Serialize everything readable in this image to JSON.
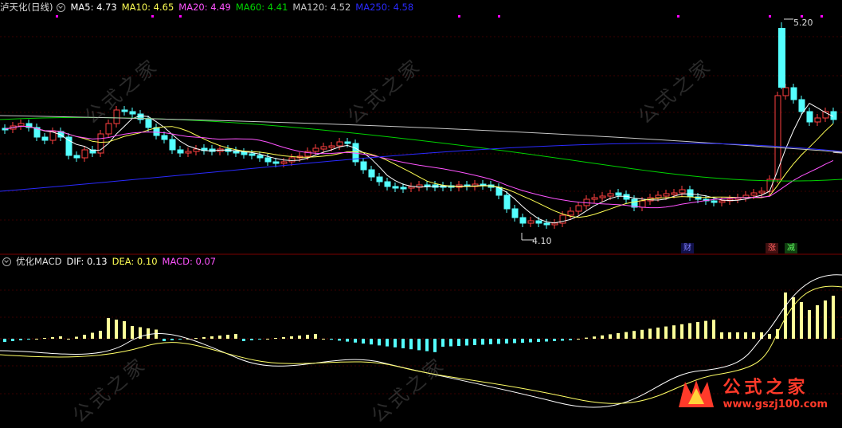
{
  "main_legend": {
    "title": "泸天化(日线)",
    "ma5": "MA5: 4.73",
    "ma10": "MA10: 4.65",
    "ma20": "MA20: 4.49",
    "ma60": "MA60: 4.41",
    "ma120": "MA120: 4.52",
    "ma250": "MA250: 4.58"
  },
  "annotations": {
    "high": "5.20",
    "low": "4.10",
    "tag_cai": "财",
    "tag_zhang": "涨",
    "tag_jian": "减"
  },
  "macd_legend": {
    "title": "优化MACD",
    "dif": "DIF: 0.13",
    "dea": "DEA: 0.10",
    "macd": "MACD: 0.07"
  },
  "watermark": {
    "text": "公式之家",
    "url": "www.gszj100.com"
  },
  "logo": {
    "text": "公式之家",
    "url": "www.gszj100.com"
  },
  "colors": {
    "up": "#ff4040",
    "down": "#54ffff",
    "ma5": "#ffffff",
    "ma10": "#ffff54",
    "ma20": "#ff54ff",
    "ma60": "#00d400",
    "ma120": "#c8c8c8",
    "ma250": "#2a2aff",
    "macd_pos": "#ffff99",
    "macd_neg": "#54ffff",
    "dea_line": "#ffff66"
  }
}
